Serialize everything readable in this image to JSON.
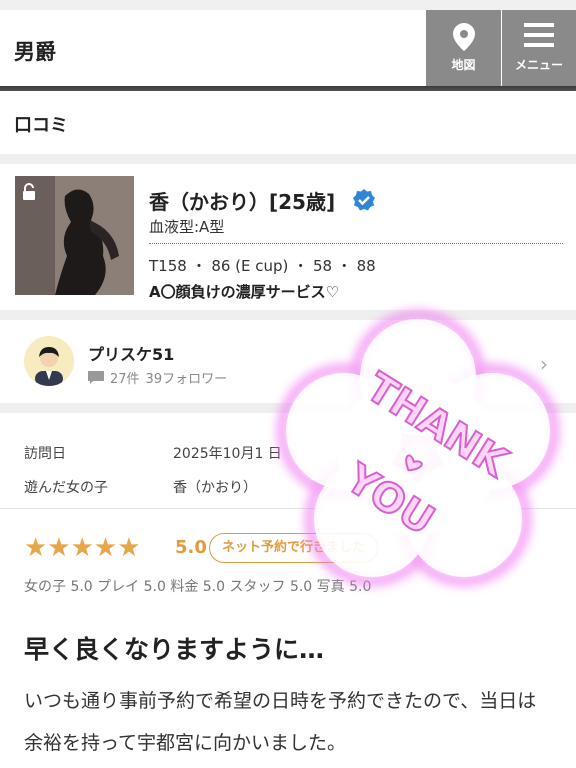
{
  "header": {
    "title": "男爵",
    "map_label": "地図",
    "menu_label": "メニュー"
  },
  "section": {
    "title": "口コミ"
  },
  "girl": {
    "name": "香（かおり）[25歳]",
    "blood_type": "血液型:A型",
    "measurements": "T158 ・ 86 (E cup) ・ 58 ・ 88",
    "catchphrase": "A〇顔負けの濃厚サービス♡"
  },
  "reviewer": {
    "name": "プリスケ51",
    "review_count": "27件",
    "followers": "39フォロワー"
  },
  "visit": {
    "date_label": "訪問日",
    "date_value": "2025年10月1 日",
    "girl_label": "遊んだ女の子",
    "girl_value": "香（かおり）"
  },
  "rating": {
    "score": "5.0",
    "stars": "★★★★★",
    "badge": "ネット予約で行きました",
    "breakdown": "女の子 5.0 プレイ 5.0 料金 5.0 スタッフ 5.0 写真 5.0"
  },
  "review": {
    "title": "早く良くなりますように…",
    "body": "いつも通り事前予約で希望の日時を予約できたので、当日は余裕を持って宇都宮に向かいました。"
  },
  "stamp": {
    "text_line1": "THANK",
    "text_line2": "YOU"
  },
  "colors": {
    "accent": "#e29b3f",
    "verified": "#2f86d8",
    "header_button": "#8a8a8a"
  }
}
